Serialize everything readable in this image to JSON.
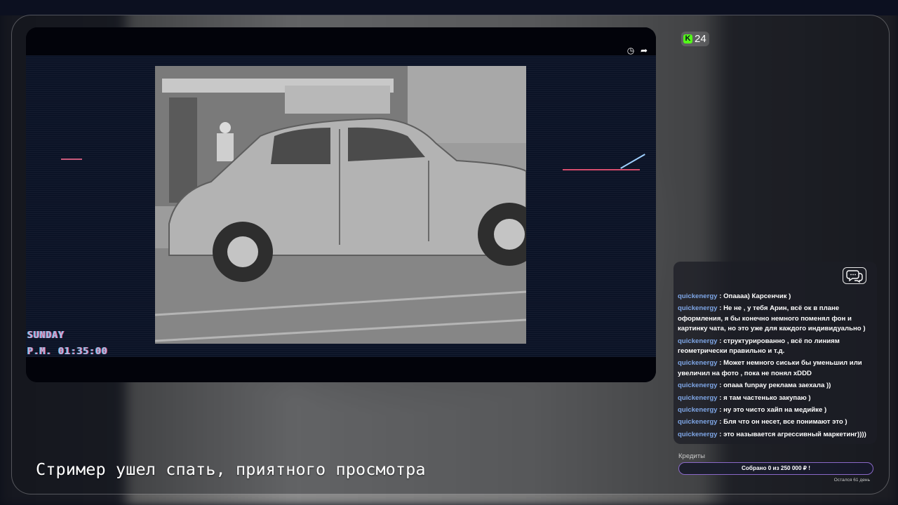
{
  "viewer_count": "24",
  "player": {
    "vhs_line1": "SUNDAY",
    "vhs_line2": "P.M. 01:35:00"
  },
  "chat": {
    "messages": [
      {
        "user": "quickenergy",
        "sep": " : ",
        "text": "Опаааа) Карсенчик )"
      },
      {
        "user": "quickenergy",
        "sep": " : ",
        "text": "Не не , у тебя Арин, всё ок в плане оформления, я бы конечно немного поменял фон и картинку чата, но это уже для каждого индивидуально )"
      },
      {
        "user": "quickenergy",
        "sep": " : ",
        "text": "структурированно , всё по линиям геометрически правильно и т.д."
      },
      {
        "user": "quickenergy",
        "sep": " : ",
        "text": "Может немного сиськи бы уменьшил или увеличил на фото , пока не понял xDDD"
      },
      {
        "user": "quickenergy",
        "sep": " : ",
        "text": "опааа funpay реклама заехала ))"
      },
      {
        "user": "quickenergy",
        "sep": " : ",
        "text": "я там частенько закупаю )"
      },
      {
        "user": "quickenergy",
        "sep": " : ",
        "text": "ну это чисто хайп на медийке )"
      },
      {
        "user": "quickenergy",
        "sep": " : ",
        "text": "Бля что он несет, все понимают это )"
      },
      {
        "user": "quickenergy",
        "sep": " : ",
        "text": "это называется агрессивный маркетинг))))"
      }
    ]
  },
  "credits": {
    "title": "Кредиты",
    "goal_text": "Собрано 0  из 250 000 ₽ !",
    "progress": 0,
    "days_left": "Осталcя 61 день"
  },
  "caption": "Стример ушел спать, приятного просмотра"
}
